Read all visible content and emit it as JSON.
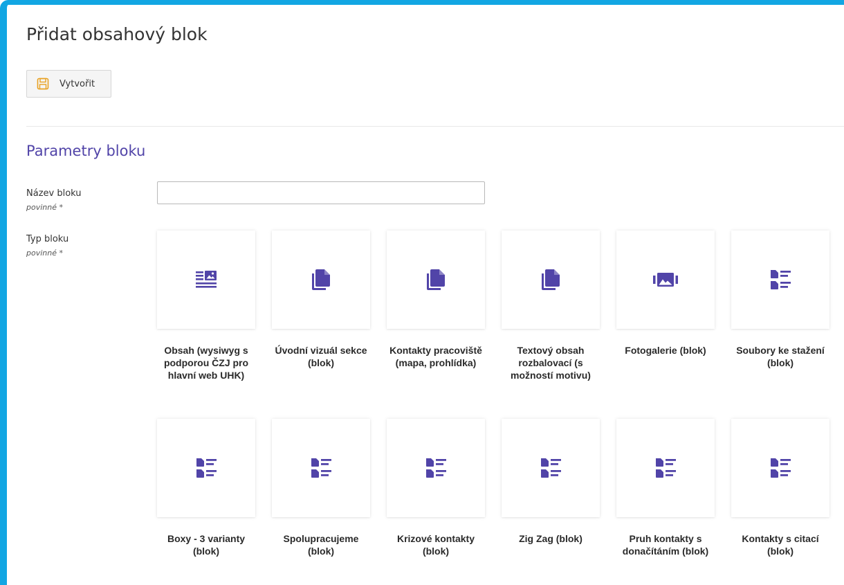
{
  "page": {
    "title": "Přidat obsahový blok"
  },
  "toolbar": {
    "create_label": "Vytvořit",
    "create_icon": "floppy-disk-icon"
  },
  "section": {
    "title": "Parametry bloku"
  },
  "fields": {
    "name": {
      "label": "Název bloku",
      "required_note": "povinné *",
      "value": ""
    },
    "type": {
      "label": "Typ bloku",
      "required_note": "povinné *"
    }
  },
  "colors": {
    "accent": "#12a6e3",
    "icon": "#5144a8",
    "heading": "#5144a8",
    "icon_save": "#e8a020"
  },
  "block_types": [
    {
      "label": "Obsah (wysiwyg s podporou ČZJ pro hlavní web UHK)",
      "icon": "article-image-icon"
    },
    {
      "label": "Úvodní vizuál sekce (blok)",
      "icon": "copy-documents-icon"
    },
    {
      "label": "Kontakty pracoviště (mapa, prohlídka)",
      "icon": "copy-documents-icon"
    },
    {
      "label": "Textový obsah rozbalovací (s možností motivu)",
      "icon": "copy-documents-icon"
    },
    {
      "label": "Fotogalerie (blok)",
      "icon": "photo-gallery-icon"
    },
    {
      "label": "Soubory ke stažení (blok)",
      "icon": "file-list-icon"
    },
    {
      "label": "Boxy - 3 varianty (blok)",
      "icon": "file-list-icon"
    },
    {
      "label": "Spolupracujeme (blok)",
      "icon": "file-list-icon"
    },
    {
      "label": "Krizové kontakty (blok)",
      "icon": "file-list-icon"
    },
    {
      "label": "Zig Zag (blok)",
      "icon": "file-list-icon"
    },
    {
      "label": "Pruh kontakty s donačítáním (blok)",
      "icon": "file-list-icon"
    },
    {
      "label": "Kontakty s citací (blok)",
      "icon": "file-list-icon"
    }
  ]
}
